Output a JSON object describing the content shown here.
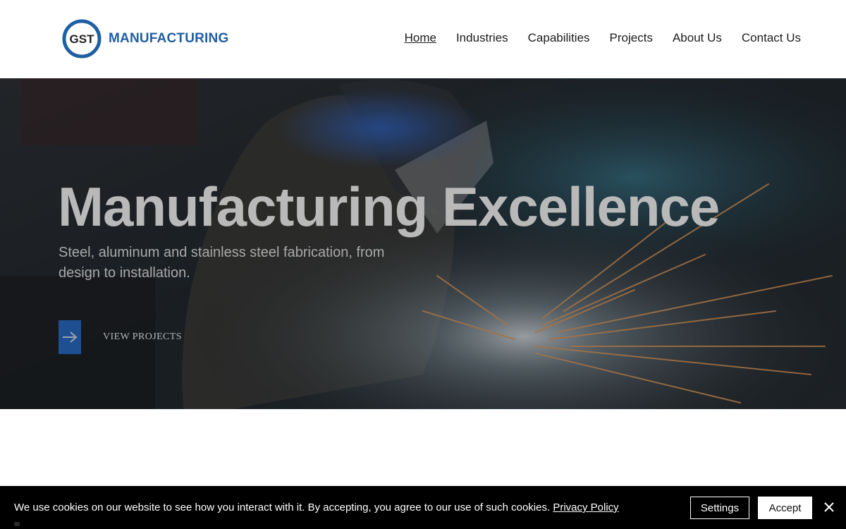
{
  "header": {
    "logo": {
      "badge_text": "GST",
      "brand_text": "MANUFACTURING",
      "brand_color": "#1f5fa3"
    },
    "nav": [
      {
        "label": "Home",
        "active": true
      },
      {
        "label": "Industries",
        "active": false
      },
      {
        "label": "Capabilities",
        "active": false
      },
      {
        "label": "Projects",
        "active": false
      },
      {
        "label": "About Us",
        "active": false
      },
      {
        "label": "Contact Us",
        "active": false
      }
    ]
  },
  "hero": {
    "title": "Manufacturing Excellence",
    "subtitle": "Steel, aluminum and stainless steel fabrication, from design to installation.",
    "cta": {
      "icon": "arrow-right-icon",
      "label": "VIEW PROJECTS",
      "accent_color": "#1d4f91"
    }
  },
  "cookie_bar": {
    "message": "We use cookies on our website to see how you interact with it. By accepting, you agree to our use of such cookies.",
    "link_label": "Privacy Policy",
    "settings_label": "Settings",
    "accept_label": "Accept",
    "close_icon": "close-icon"
  }
}
